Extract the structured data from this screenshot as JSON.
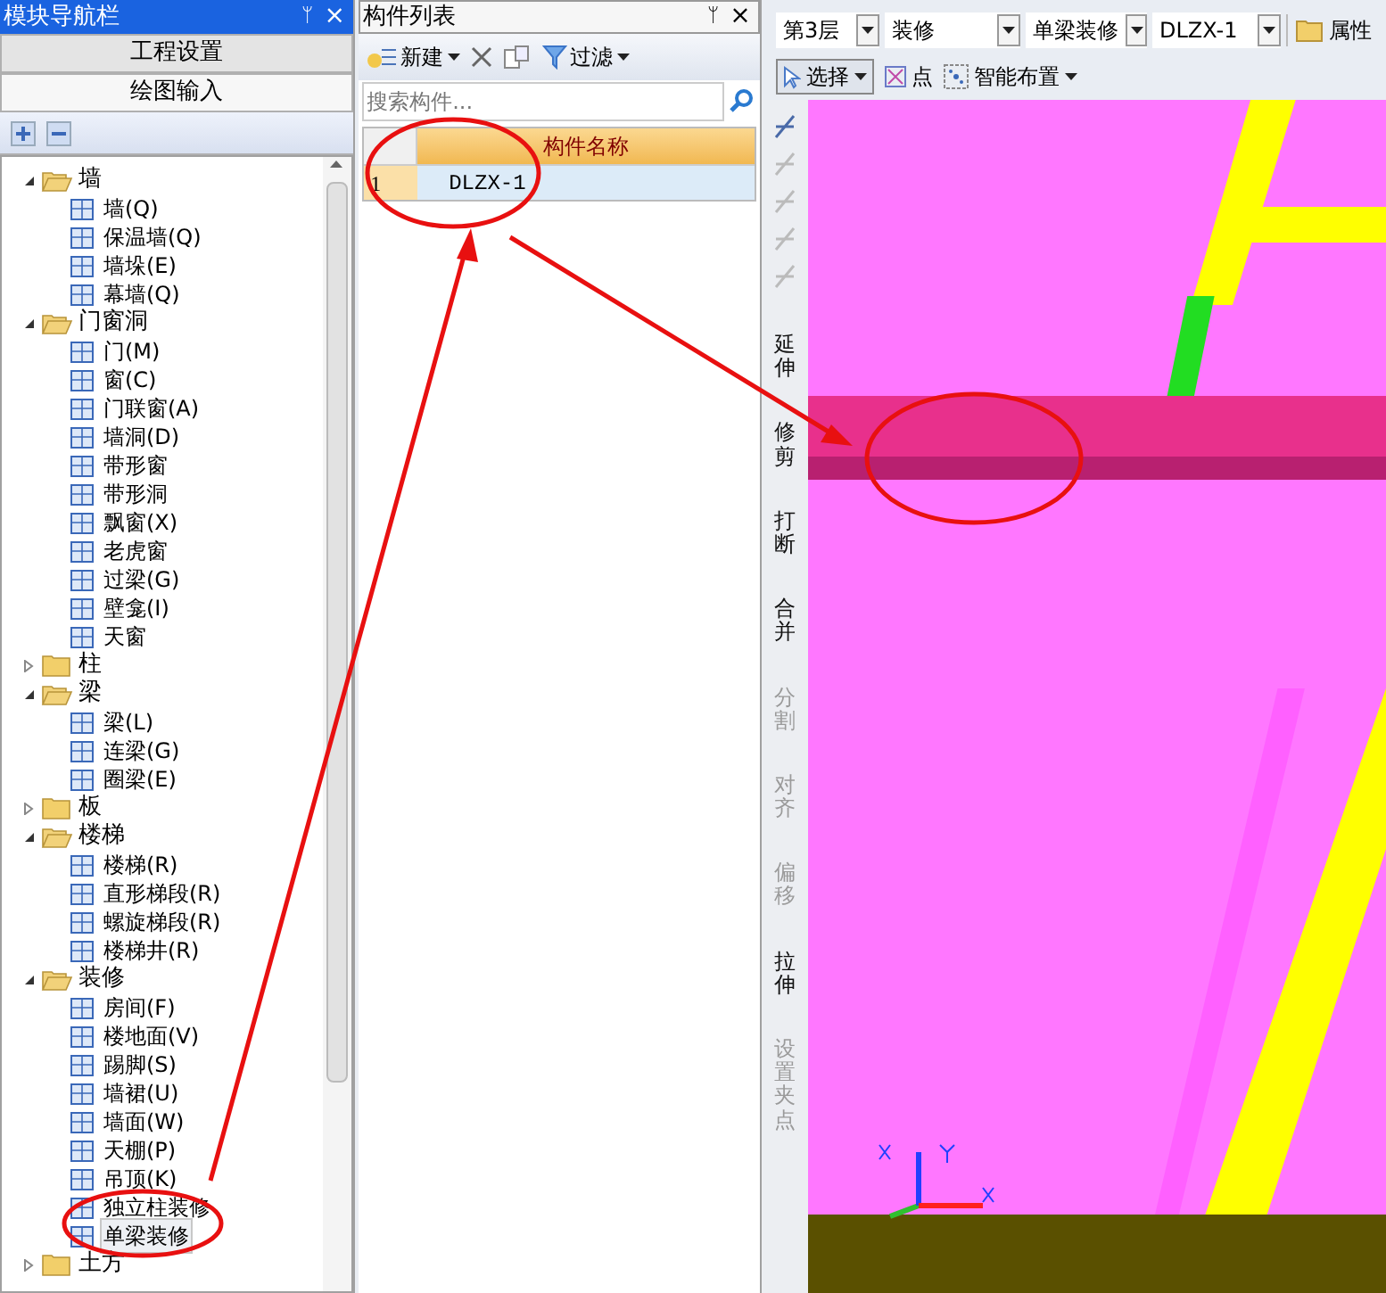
{
  "nav_panel": {
    "title": "模块导航栏",
    "pin": "ᛘ",
    "close": "×",
    "sections": [
      {
        "label": "工程设置",
        "selected": false
      },
      {
        "label": "绘图输入",
        "selected": true
      }
    ],
    "tree": [
      {
        "label": "墙",
        "expanded": true,
        "children": [
          {
            "label": "墙(Q)",
            "selected": false
          },
          {
            "label": "保温墙(Q)",
            "selected": false
          },
          {
            "label": "墙垛(E)",
            "selected": false
          },
          {
            "label": "幕墙(Q)",
            "selected": false
          }
        ]
      },
      {
        "label": "门窗洞",
        "expanded": true,
        "children": [
          {
            "label": "门(M)",
            "selected": false
          },
          {
            "label": "窗(C)",
            "selected": false
          },
          {
            "label": "门联窗(A)",
            "selected": false
          },
          {
            "label": "墙洞(D)",
            "selected": false
          },
          {
            "label": "带形窗",
            "selected": false
          },
          {
            "label": "带形洞",
            "selected": false
          },
          {
            "label": "飘窗(X)",
            "selected": false
          },
          {
            "label": "老虎窗",
            "selected": false
          },
          {
            "label": "过梁(G)",
            "selected": false
          },
          {
            "label": "壁龛(I)",
            "selected": false
          },
          {
            "label": "天窗",
            "selected": false
          }
        ]
      },
      {
        "label": "柱",
        "expanded": false
      },
      {
        "label": "梁",
        "expanded": true,
        "children": [
          {
            "label": "梁(L)",
            "selected": false
          },
          {
            "label": "连梁(G)",
            "selected": false
          },
          {
            "label": "圈梁(E)",
            "selected": false
          }
        ]
      },
      {
        "label": "板",
        "expanded": false
      },
      {
        "label": "楼梯",
        "expanded": true,
        "children": [
          {
            "label": "楼梯(R)",
            "selected": false
          },
          {
            "label": "直形梯段(R)",
            "selected": false
          },
          {
            "label": "螺旋梯段(R)",
            "selected": false
          },
          {
            "label": "楼梯井(R)",
            "selected": false
          }
        ]
      },
      {
        "label": "装修",
        "expanded": true,
        "children": [
          {
            "label": "房间(F)",
            "selected": false
          },
          {
            "label": "楼地面(V)",
            "selected": false
          },
          {
            "label": "踢脚(S)",
            "selected": false
          },
          {
            "label": "墙裙(U)",
            "selected": false
          },
          {
            "label": "墙面(W)",
            "selected": false
          },
          {
            "label": "天棚(P)",
            "selected": false
          },
          {
            "label": "吊顶(K)",
            "selected": false
          },
          {
            "label": "独立柱装修",
            "selected": false
          },
          {
            "label": "单梁装修",
            "selected": true
          }
        ]
      },
      {
        "label": "土方",
        "expanded": false
      }
    ]
  },
  "list_panel": {
    "title": "构件列表",
    "pin": "ᛘ",
    "close": "×",
    "new": "新建",
    "filter": "过滤",
    "search": {
      "placeholder": "搜索构件..."
    },
    "column": "构件名称",
    "rows": [
      {
        "index": "1",
        "name": "DLZX-1",
        "selected": true
      }
    ]
  },
  "toolbar": {
    "dropdowns": [
      "第3层",
      "装修",
      "单梁装修",
      "DLZX-1"
    ],
    "properties": "属性",
    "select": {
      "label": "选择",
      "pressed": true
    },
    "point": "点",
    "smart": "智能布置"
  },
  "side_tools": [
    {
      "label": "延伸",
      "disabled": false
    },
    {
      "label": "修剪",
      "disabled": false
    },
    {
      "label": "打断",
      "disabled": false
    },
    {
      "label": "合并",
      "disabled": false
    },
    {
      "label": "分割",
      "disabled": true
    },
    {
      "label": "对齐",
      "disabled": true
    },
    {
      "label": "偏移",
      "disabled": true
    },
    {
      "label": "拉伸",
      "disabled": false
    },
    {
      "label": "设置夹点",
      "disabled": true
    }
  ]
}
